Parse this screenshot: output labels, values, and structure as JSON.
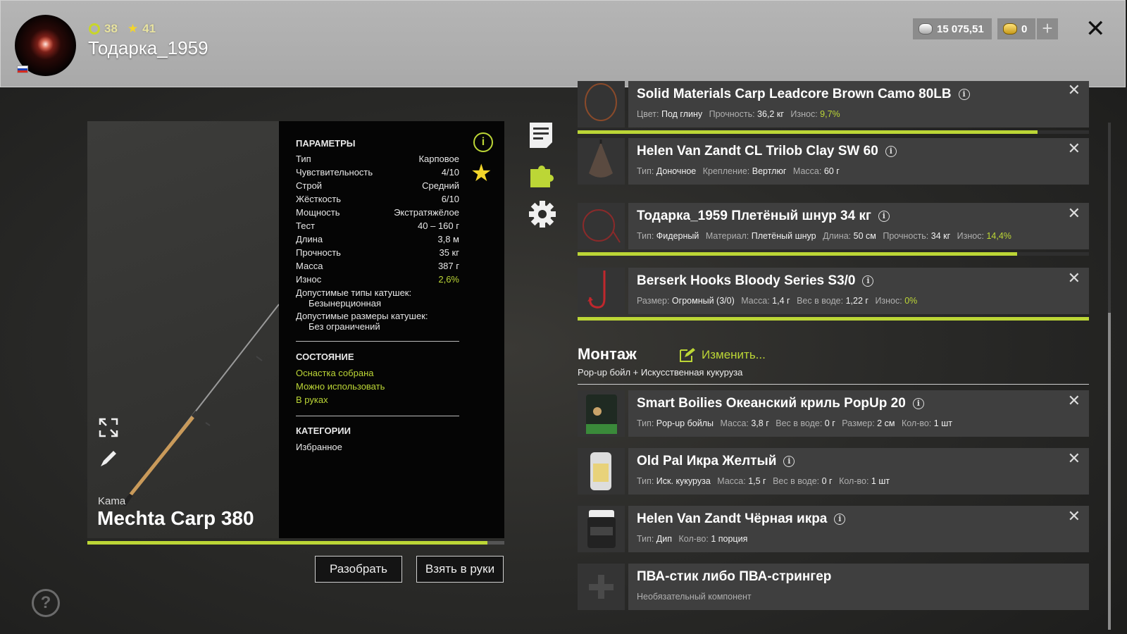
{
  "header": {
    "level": "38",
    "stars": "41",
    "username": "Тодарка_1959",
    "silver": "15 075,51",
    "gold": "0"
  },
  "rod": {
    "brand": "Kama",
    "name": "Mechta Carp 380",
    "wear_fraction": 0.96,
    "params_title": "ПАРАМЕТРЫ",
    "params": [
      {
        "label": "Тип",
        "value": "Карповое"
      },
      {
        "label": "Чувствительность",
        "value": "4/10"
      },
      {
        "label": "Строй",
        "value": "Средний"
      },
      {
        "label": "Жёсткость",
        "value": "6/10"
      },
      {
        "label": "Мощность",
        "value": "Экстратяжёлое"
      },
      {
        "label": "Тест",
        "value": "40 – 160 г"
      },
      {
        "label": "Длина",
        "value": "3,8 м"
      },
      {
        "label": "Прочность",
        "value": "35 кг"
      },
      {
        "label": "Масса",
        "value": "387 г"
      },
      {
        "label": "Износ",
        "value": "2,6%"
      }
    ],
    "reel_types_label": "Допустимые типы катушек:",
    "reel_types_value": "Безынерционная",
    "reel_sizes_label": "Допустимые размеры катушек:",
    "reel_sizes_value": "Без ограничений",
    "state_title": "СОСТОЯНИЕ",
    "states": [
      "Оснастка собрана",
      "Можно использовать",
      "В руках"
    ],
    "categories_title": "КАТЕГОРИИ",
    "category": "Избранное"
  },
  "buttons": {
    "disassemble": "Разобрать",
    "take": "Взять в руки"
  },
  "items": [
    {
      "title": "Solid Materials Carp Leadcore Brown Camo 80LB",
      "props": [
        [
          "Цвет:",
          "Под глину"
        ],
        [
          "Прочность:",
          "36,2 кг"
        ],
        [
          "Износ:",
          "9,7%"
        ]
      ],
      "wear": 0.9
    },
    {
      "title": "Helen Van Zandt CL Trilob Clay SW 60",
      "props": [
        [
          "Тип:",
          "Доночное"
        ],
        [
          "Крепление:",
          "Вертлюг"
        ],
        [
          "Масса:",
          "60 г"
        ]
      ]
    },
    {
      "title": "Тодарка_1959 Плетёный шнур 34 кг",
      "props": [
        [
          "Тип:",
          "Фидерный"
        ],
        [
          "Материал:",
          "Плетёный шнур"
        ],
        [
          "Длина:",
          "50 см"
        ],
        [
          "Прочность:",
          "34 кг"
        ],
        [
          "Износ:",
          "14,4%"
        ]
      ],
      "wear": 0.86
    },
    {
      "title": "Berserk Hooks Bloody Series S3/0",
      "props": [
        [
          "Размер:",
          "Огромный (3/0)"
        ],
        [
          "Масса:",
          "1,4 г"
        ],
        [
          "Вес в воде:",
          "1,22 г"
        ],
        [
          "Износ:",
          "0%"
        ]
      ],
      "wear": 1.0
    }
  ],
  "montage": {
    "title": "Монтаж",
    "edit": "Изменить...",
    "subtitle": "Pop-up бойл  +  Искусственная кукуруза"
  },
  "baits": [
    {
      "title": "Smart Boilies Океанский криль PopUp 20",
      "props": [
        [
          "Тип:",
          "Pop-up бойлы"
        ],
        [
          "Масса:",
          "3,8 г"
        ],
        [
          "Вес в воде:",
          "0 г"
        ],
        [
          "Размер:",
          "2 см"
        ],
        [
          "Кол-во:",
          "1 шт"
        ]
      ]
    },
    {
      "title": "Old Pal Икра Желтый",
      "props": [
        [
          "Тип:",
          "Иск. кукуруза"
        ],
        [
          "Масса:",
          "1,5 г"
        ],
        [
          "Вес в воде:",
          "0 г"
        ],
        [
          "Кол-во:",
          "1 шт"
        ]
      ]
    },
    {
      "title": "Helen Van Zandt Чёрная икра",
      "props": [
        [
          "Тип:",
          "Дип"
        ],
        [
          "Кол-во:",
          "1 порция"
        ]
      ]
    },
    {
      "title": "ПВА-стик либо ПВА-стрингер",
      "subtitle": "Необязательный компонент"
    }
  ],
  "colors": {
    "accent": "#bcd636",
    "star": "#f3d52a"
  },
  "icons": [
    "info-icon",
    "star-icon",
    "list-icon",
    "puzzle-icon",
    "gear-icon",
    "expand-icon",
    "pencil-icon",
    "help-icon",
    "close-icon",
    "plus-icon"
  ]
}
